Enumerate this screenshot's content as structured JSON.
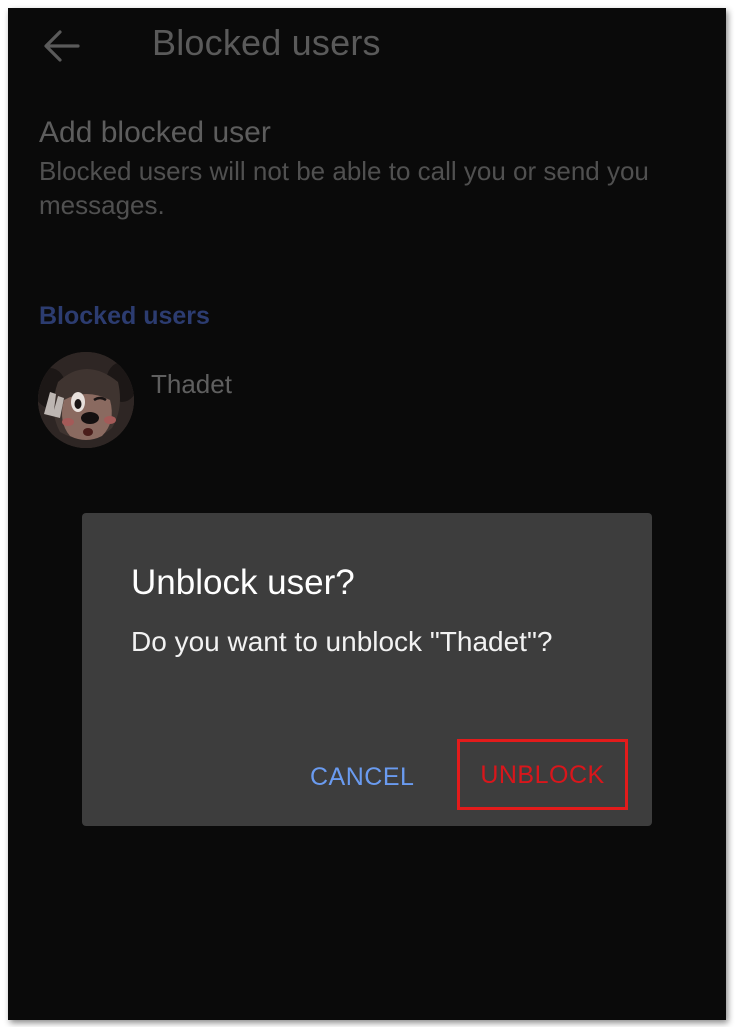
{
  "appbar": {
    "title": "Blocked users",
    "back_icon": "arrow-back-icon"
  },
  "add_blocked": {
    "title": "Add blocked user",
    "subtitle": "Blocked users will not be able to call you or send you messages."
  },
  "section": {
    "header": "Blocked users"
  },
  "blocked_users": [
    {
      "name": "Thadet",
      "avatar_icon": "cartoon-mouse-avatar"
    }
  ],
  "dialog": {
    "title": "Unblock user?",
    "message": "Do you want to unblock \"Thadet\"?",
    "cancel_label": "CANCEL",
    "unblock_label": "UNBLOCK"
  },
  "colors": {
    "background": "#0a0a0a",
    "dialog": "#3d3d3d",
    "accent_blue": "#6a9bf0",
    "section_header": "#2c3c70",
    "highlight_red": "#e31b1b"
  }
}
